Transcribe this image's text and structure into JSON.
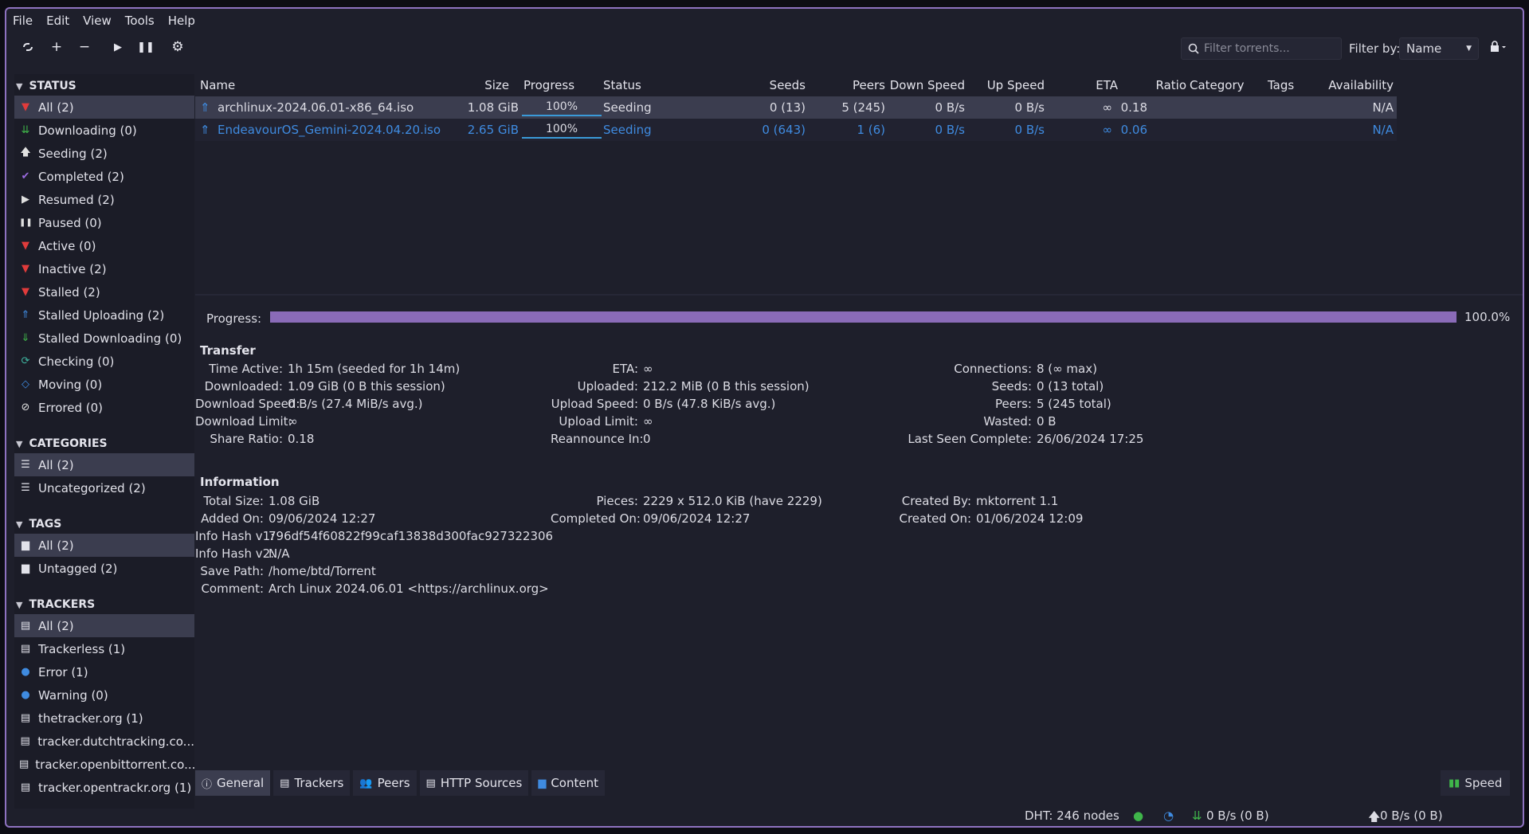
{
  "menu": [
    "File",
    "Edit",
    "View",
    "Tools",
    "Help"
  ],
  "toolbar": {
    "search_placeholder": "Filter torrents...",
    "filter_label": "Filter by:",
    "filter_value": "Name"
  },
  "sidebar": {
    "status_title": "STATUS",
    "status": [
      {
        "label": "All (2)",
        "icon": "funnel-icon",
        "color": "#e03b3b"
      },
      {
        "label": "Downloading (0)",
        "icon": "download-icon",
        "color": "#3fb54a"
      },
      {
        "label": "Seeding (2)",
        "icon": "upload-icon",
        "color": "#e0e0e0"
      },
      {
        "label": "Completed (2)",
        "icon": "check-icon",
        "color": "#9b6be0"
      },
      {
        "label": "Resumed (2)",
        "icon": "play-icon",
        "color": "#e0e0e0"
      },
      {
        "label": "Paused (0)",
        "icon": "pause-icon",
        "color": "#e0e0e0"
      },
      {
        "label": "Active (0)",
        "icon": "funnel-icon",
        "color": "#e03b3b"
      },
      {
        "label": "Inactive (2)",
        "icon": "funnel-icon",
        "color": "#e03b3b"
      },
      {
        "label": "Stalled (2)",
        "icon": "funnel-icon",
        "color": "#e03b3b"
      },
      {
        "label": "Stalled Uploading (2)",
        "icon": "stalled-upload-icon",
        "color": "#3f8be0"
      },
      {
        "label": "Stalled Downloading (0)",
        "icon": "stalled-download-icon",
        "color": "#3fb54a"
      },
      {
        "label": "Checking (0)",
        "icon": "refresh-icon",
        "color": "#3fb5a0"
      },
      {
        "label": "Moving (0)",
        "icon": "move-icon",
        "color": "#3f8be0"
      },
      {
        "label": "Errored (0)",
        "icon": "error-icon",
        "color": "#e0e0e0"
      }
    ],
    "categories_title": "CATEGORIES",
    "categories": [
      "All (2)",
      "Uncategorized (2)"
    ],
    "tags_title": "TAGS",
    "tags": [
      "All (2)",
      "Untagged (2)"
    ],
    "trackers_title": "TRACKERS",
    "trackers": [
      "All (2)",
      "Trackerless (1)",
      "Error (1)",
      "Warning (0)",
      "thetracker.org (1)",
      "tracker.dutchtracking.co...",
      "tracker.openbittorrent.co...",
      "tracker.opentrackr.org (1)"
    ]
  },
  "table": {
    "headers": [
      "Name",
      "Size",
      "Progress",
      "Status",
      "Seeds",
      "Peers",
      "Down Speed",
      "Up Speed",
      "ETA",
      "Ratio",
      "Category",
      "Tags",
      "Availability"
    ],
    "rows": [
      {
        "name": "archlinux-2024.06.01-x86_64.iso",
        "size": "1.08 GiB",
        "progress": "100%",
        "status": "Seeding",
        "seeds": "0 (13)",
        "peers": "5 (245)",
        "down": "0 B/s",
        "up": "0 B/s",
        "eta": "∞",
        "ratio": "0.18",
        "availability": "N/A"
      },
      {
        "name": "EndeavourOS_Gemini-2024.04.20.iso",
        "size": "2.65 GiB",
        "progress": "100%",
        "status": "Seeding",
        "seeds": "0 (643)",
        "peers": "1 (6)",
        "down": "0 B/s",
        "up": "0 B/s",
        "eta": "∞",
        "ratio": "0.06",
        "availability": "N/A"
      }
    ]
  },
  "details": {
    "progress_label": "Progress:",
    "progress_fraction": 1.0,
    "progress_value": "100.0%",
    "transfer_title": "Transfer",
    "information_title": "Information",
    "transfer": {
      "col1": [
        {
          "k": "Time Active:",
          "v": "1h 15m (seeded for 1h 14m)"
        },
        {
          "k": "Downloaded:",
          "v": "1.09 GiB (0 B this session)"
        },
        {
          "k": "Download Speed:",
          "v": "0 B/s (27.4 MiB/s avg.)"
        },
        {
          "k": "Download Limit:",
          "v": "∞"
        },
        {
          "k": "Share Ratio:",
          "v": "0.18"
        }
      ],
      "col2": [
        {
          "k": "ETA:",
          "v": "∞"
        },
        {
          "k": "Uploaded:",
          "v": "212.2 MiB (0 B this session)"
        },
        {
          "k": "Upload Speed:",
          "v": "0 B/s (47.8 KiB/s avg.)"
        },
        {
          "k": "Upload Limit:",
          "v": "∞"
        },
        {
          "k": "Reannounce In:",
          "v": "0"
        }
      ],
      "col3": [
        {
          "k": "Connections:",
          "v": "8 (∞ max)"
        },
        {
          "k": "Seeds:",
          "v": "0 (13 total)"
        },
        {
          "k": "Peers:",
          "v": "5 (245 total)"
        },
        {
          "k": "Wasted:",
          "v": "0 B"
        },
        {
          "k": "Last Seen Complete:",
          "v": "26/06/2024 17:25"
        }
      ]
    },
    "information": {
      "col1": [
        {
          "k": "Total Size:",
          "v": "1.08 GiB"
        },
        {
          "k": "Added On:",
          "v": "09/06/2024 12:27"
        },
        {
          "k": "Info Hash v1:",
          "v": "796df54f60822f99caf13838d300fac927322306"
        },
        {
          "k": "Info Hash v2:",
          "v": "N/A"
        },
        {
          "k": "Save Path:",
          "v": "/home/btd/Torrent"
        },
        {
          "k": "Comment:",
          "v": "Arch Linux 2024.06.01 <https://archlinux.org>"
        }
      ],
      "col2": [
        {
          "k": "Pieces:",
          "v": "2229 x 512.0 KiB (have 2229)"
        },
        {
          "k": "Completed On:",
          "v": "09/06/2024 12:27"
        }
      ],
      "col3": [
        {
          "k": "Created By:",
          "v": "mktorrent 1.1"
        },
        {
          "k": "Created On:",
          "v": "01/06/2024 12:09"
        }
      ]
    }
  },
  "tabs": [
    "General",
    "Trackers",
    "Peers",
    "HTTP Sources",
    "Content"
  ],
  "speed_tab": "Speed",
  "statusbar": {
    "dht": "DHT: 246 nodes",
    "down": "0 B/s (0 B)",
    "up": "0 B/s (0 B)"
  },
  "colors": {
    "accent": "#8a6bb8",
    "link_blue": "#3f8be0",
    "selection": "#3b3d4f"
  }
}
